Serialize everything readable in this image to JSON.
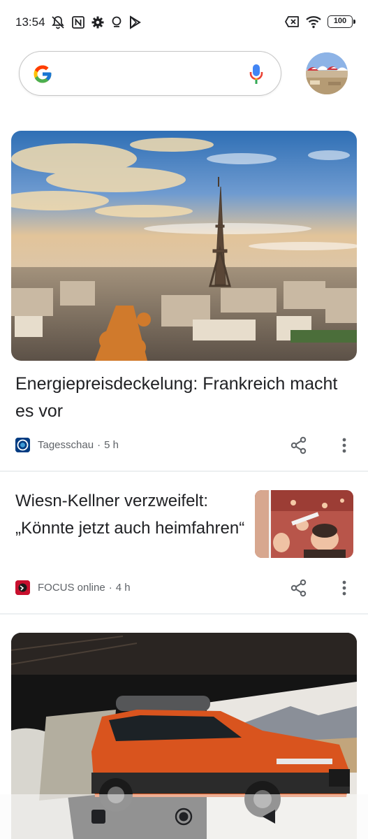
{
  "status_bar": {
    "time": "13:54",
    "battery": "100",
    "left_icons": [
      "bell-muted-icon",
      "nfc-icon",
      "gear-icon",
      "location-icon",
      "play-store-icon"
    ],
    "right_icons": [
      "no-sim-icon",
      "wifi-icon",
      "battery-icon"
    ]
  },
  "search": {
    "placeholder": "",
    "icons": [
      "google-g-icon",
      "mic-icon"
    ],
    "colors": {
      "blue": "#4285F4",
      "red": "#EA4335",
      "yellow": "#FBBC05",
      "green": "#34A853"
    }
  },
  "feed": {
    "articles": [
      {
        "title": "Energiepreisdeckelung: Frankreich macht es vor",
        "source": "Tagesschau",
        "separator": "·",
        "time": "5 h",
        "image": "eiffel-tower-paris-skyline"
      },
      {
        "title": "Wiesn-Kellner verzweifelt: „Könnte jetzt auch heimfahren“",
        "source": "FOCUS online",
        "separator": "·",
        "time": "4 h",
        "image": "beer-tent-crowd-thumbnail"
      },
      {
        "image": "orange-suv-with-tent"
      }
    ]
  },
  "nav_bar": {
    "icons": [
      "recents-square-icon",
      "home-circle-icon",
      "back-triangle-icon"
    ]
  }
}
